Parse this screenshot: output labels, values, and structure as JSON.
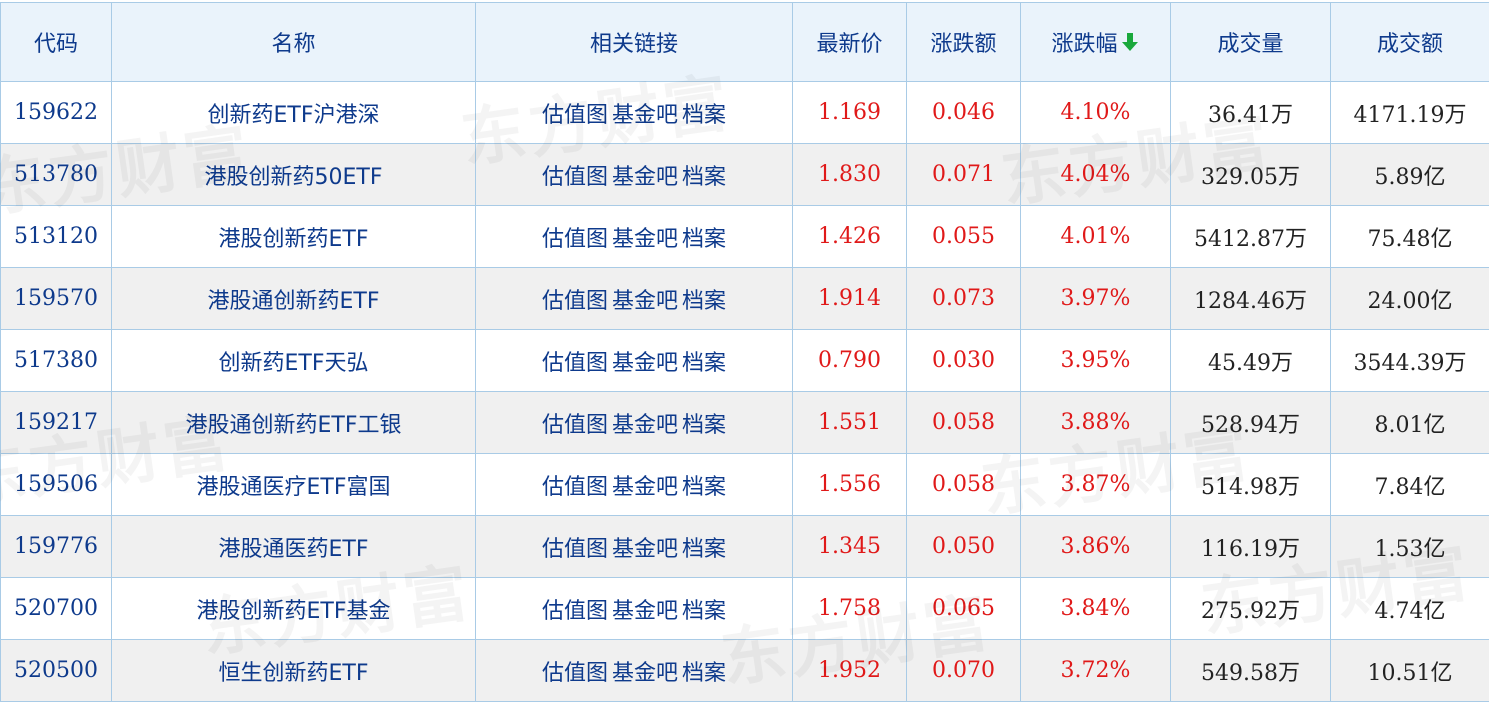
{
  "watermark_text": "东方财富",
  "headers": {
    "code": "代码",
    "name": "名称",
    "links": "相关链接",
    "price": "最新价",
    "change": "涨跌额",
    "change_pct": "涨跌幅",
    "volume": "成交量",
    "amount": "成交额"
  },
  "sort_icon": "arrow-down-icon",
  "colors": {
    "sort_arrow": "#19a83c",
    "up": "#e01919",
    "header_text": "#0e3a8c"
  },
  "rows": [
    {
      "code": "159622",
      "name": "创新药ETF沪港深",
      "links": [
        "估值图",
        "基金吧",
        "档案"
      ],
      "price": "1.169",
      "change": "0.046",
      "change_pct": "4.10%",
      "volume": "36.41万",
      "amount": "4171.19万"
    },
    {
      "code": "513780",
      "name": "港股创新药50ETF",
      "links": [
        "估值图",
        "基金吧",
        "档案"
      ],
      "price": "1.830",
      "change": "0.071",
      "change_pct": "4.04%",
      "volume": "329.05万",
      "amount": "5.89亿"
    },
    {
      "code": "513120",
      "name": "港股创新药ETF",
      "links": [
        "估值图",
        "基金吧",
        "档案"
      ],
      "price": "1.426",
      "change": "0.055",
      "change_pct": "4.01%",
      "volume": "5412.87万",
      "amount": "75.48亿"
    },
    {
      "code": "159570",
      "name": "港股通创新药ETF",
      "links": [
        "估值图",
        "基金吧",
        "档案"
      ],
      "price": "1.914",
      "change": "0.073",
      "change_pct": "3.97%",
      "volume": "1284.46万",
      "amount": "24.00亿"
    },
    {
      "code": "517380",
      "name": "创新药ETF天弘",
      "links": [
        "估值图",
        "基金吧",
        "档案"
      ],
      "price": "0.790",
      "change": "0.030",
      "change_pct": "3.95%",
      "volume": "45.49万",
      "amount": "3544.39万"
    },
    {
      "code": "159217",
      "name": "港股通创新药ETF工银",
      "links": [
        "估值图",
        "基金吧",
        "档案"
      ],
      "price": "1.551",
      "change": "0.058",
      "change_pct": "3.88%",
      "volume": "528.94万",
      "amount": "8.01亿"
    },
    {
      "code": "159506",
      "name": "港股通医疗ETF富国",
      "links": [
        "估值图",
        "基金吧",
        "档案"
      ],
      "price": "1.556",
      "change": "0.058",
      "change_pct": "3.87%",
      "volume": "514.98万",
      "amount": "7.84亿"
    },
    {
      "code": "159776",
      "name": "港股通医药ETF",
      "links": [
        "估值图",
        "基金吧",
        "档案"
      ],
      "price": "1.345",
      "change": "0.050",
      "change_pct": "3.86%",
      "volume": "116.19万",
      "amount": "1.53亿"
    },
    {
      "code": "520700",
      "name": "港股创新药ETF基金",
      "links": [
        "估值图",
        "基金吧",
        "档案"
      ],
      "price": "1.758",
      "change": "0.065",
      "change_pct": "3.84%",
      "volume": "275.92万",
      "amount": "4.74亿"
    },
    {
      "code": "520500",
      "name": "恒生创新药ETF",
      "links": [
        "估值图",
        "基金吧",
        "档案"
      ],
      "price": "1.952",
      "change": "0.070",
      "change_pct": "3.72%",
      "volume": "549.58万",
      "amount": "10.51亿"
    }
  ]
}
